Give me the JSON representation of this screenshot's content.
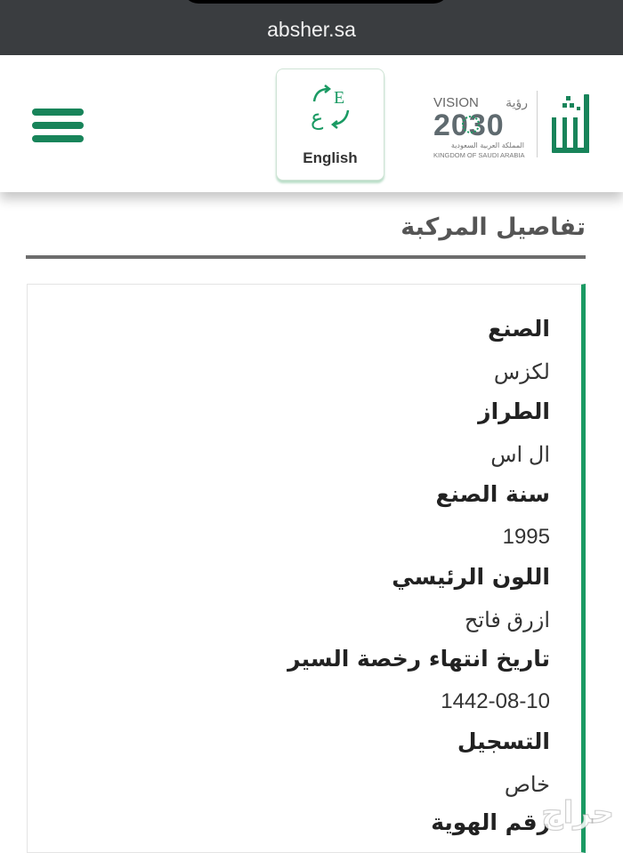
{
  "browser": {
    "url": "absher.sa"
  },
  "header": {
    "language_button": "English",
    "vision_logo": {
      "vision_word": "VISION",
      "vision_arabic": "رؤية",
      "year": "2030",
      "kingdom_arabic": "المملكة العربية السعودية",
      "kingdom_english": "KINGDOM OF SAUDI ARABIA"
    },
    "brand_logo": "أبشر",
    "accent_color": "#18845a"
  },
  "page": {
    "title": "تفاصيل المركبة",
    "fields": [
      {
        "label": "الصنع",
        "value": "لكزس"
      },
      {
        "label": "الطراز",
        "value": "ال اس"
      },
      {
        "label": "سنة الصنع",
        "value": "1995"
      },
      {
        "label": "اللون الرئيسي",
        "value": "ازرق فاتح"
      },
      {
        "label": "تاريخ انتهاء رخصة السير",
        "value": "1442-08-10"
      },
      {
        "label": "التسجيل",
        "value": "خاص"
      },
      {
        "label": "رقم الهوية",
        "value": ""
      }
    ]
  },
  "watermark": {
    "text": "حراج"
  }
}
